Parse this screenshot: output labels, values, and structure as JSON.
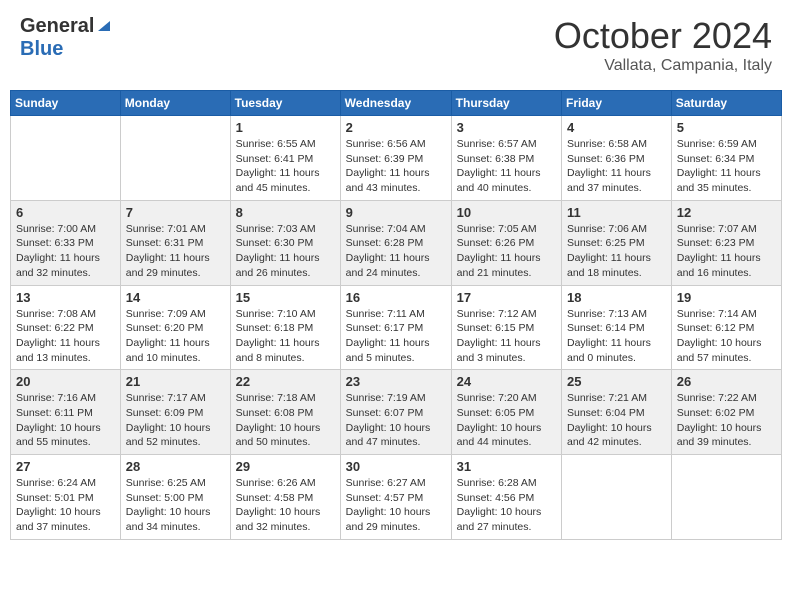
{
  "header": {
    "logo_general": "General",
    "logo_blue": "Blue",
    "title": "October 2024",
    "location": "Vallata, Campania, Italy"
  },
  "days_of_week": [
    "Sunday",
    "Monday",
    "Tuesday",
    "Wednesday",
    "Thursday",
    "Friday",
    "Saturday"
  ],
  "weeks": [
    [
      {
        "day": "",
        "info": ""
      },
      {
        "day": "",
        "info": ""
      },
      {
        "day": "1",
        "info": "Sunrise: 6:55 AM\nSunset: 6:41 PM\nDaylight: 11 hours and 45 minutes."
      },
      {
        "day": "2",
        "info": "Sunrise: 6:56 AM\nSunset: 6:39 PM\nDaylight: 11 hours and 43 minutes."
      },
      {
        "day": "3",
        "info": "Sunrise: 6:57 AM\nSunset: 6:38 PM\nDaylight: 11 hours and 40 minutes."
      },
      {
        "day": "4",
        "info": "Sunrise: 6:58 AM\nSunset: 6:36 PM\nDaylight: 11 hours and 37 minutes."
      },
      {
        "day": "5",
        "info": "Sunrise: 6:59 AM\nSunset: 6:34 PM\nDaylight: 11 hours and 35 minutes."
      }
    ],
    [
      {
        "day": "6",
        "info": "Sunrise: 7:00 AM\nSunset: 6:33 PM\nDaylight: 11 hours and 32 minutes."
      },
      {
        "day": "7",
        "info": "Sunrise: 7:01 AM\nSunset: 6:31 PM\nDaylight: 11 hours and 29 minutes."
      },
      {
        "day": "8",
        "info": "Sunrise: 7:03 AM\nSunset: 6:30 PM\nDaylight: 11 hours and 26 minutes."
      },
      {
        "day": "9",
        "info": "Sunrise: 7:04 AM\nSunset: 6:28 PM\nDaylight: 11 hours and 24 minutes."
      },
      {
        "day": "10",
        "info": "Sunrise: 7:05 AM\nSunset: 6:26 PM\nDaylight: 11 hours and 21 minutes."
      },
      {
        "day": "11",
        "info": "Sunrise: 7:06 AM\nSunset: 6:25 PM\nDaylight: 11 hours and 18 minutes."
      },
      {
        "day": "12",
        "info": "Sunrise: 7:07 AM\nSunset: 6:23 PM\nDaylight: 11 hours and 16 minutes."
      }
    ],
    [
      {
        "day": "13",
        "info": "Sunrise: 7:08 AM\nSunset: 6:22 PM\nDaylight: 11 hours and 13 minutes."
      },
      {
        "day": "14",
        "info": "Sunrise: 7:09 AM\nSunset: 6:20 PM\nDaylight: 11 hours and 10 minutes."
      },
      {
        "day": "15",
        "info": "Sunrise: 7:10 AM\nSunset: 6:18 PM\nDaylight: 11 hours and 8 minutes."
      },
      {
        "day": "16",
        "info": "Sunrise: 7:11 AM\nSunset: 6:17 PM\nDaylight: 11 hours and 5 minutes."
      },
      {
        "day": "17",
        "info": "Sunrise: 7:12 AM\nSunset: 6:15 PM\nDaylight: 11 hours and 3 minutes."
      },
      {
        "day": "18",
        "info": "Sunrise: 7:13 AM\nSunset: 6:14 PM\nDaylight: 11 hours and 0 minutes."
      },
      {
        "day": "19",
        "info": "Sunrise: 7:14 AM\nSunset: 6:12 PM\nDaylight: 10 hours and 57 minutes."
      }
    ],
    [
      {
        "day": "20",
        "info": "Sunrise: 7:16 AM\nSunset: 6:11 PM\nDaylight: 10 hours and 55 minutes."
      },
      {
        "day": "21",
        "info": "Sunrise: 7:17 AM\nSunset: 6:09 PM\nDaylight: 10 hours and 52 minutes."
      },
      {
        "day": "22",
        "info": "Sunrise: 7:18 AM\nSunset: 6:08 PM\nDaylight: 10 hours and 50 minutes."
      },
      {
        "day": "23",
        "info": "Sunrise: 7:19 AM\nSunset: 6:07 PM\nDaylight: 10 hours and 47 minutes."
      },
      {
        "day": "24",
        "info": "Sunrise: 7:20 AM\nSunset: 6:05 PM\nDaylight: 10 hours and 44 minutes."
      },
      {
        "day": "25",
        "info": "Sunrise: 7:21 AM\nSunset: 6:04 PM\nDaylight: 10 hours and 42 minutes."
      },
      {
        "day": "26",
        "info": "Sunrise: 7:22 AM\nSunset: 6:02 PM\nDaylight: 10 hours and 39 minutes."
      }
    ],
    [
      {
        "day": "27",
        "info": "Sunrise: 6:24 AM\nSunset: 5:01 PM\nDaylight: 10 hours and 37 minutes."
      },
      {
        "day": "28",
        "info": "Sunrise: 6:25 AM\nSunset: 5:00 PM\nDaylight: 10 hours and 34 minutes."
      },
      {
        "day": "29",
        "info": "Sunrise: 6:26 AM\nSunset: 4:58 PM\nDaylight: 10 hours and 32 minutes."
      },
      {
        "day": "30",
        "info": "Sunrise: 6:27 AM\nSunset: 4:57 PM\nDaylight: 10 hours and 29 minutes."
      },
      {
        "day": "31",
        "info": "Sunrise: 6:28 AM\nSunset: 4:56 PM\nDaylight: 10 hours and 27 minutes."
      },
      {
        "day": "",
        "info": ""
      },
      {
        "day": "",
        "info": ""
      }
    ]
  ]
}
